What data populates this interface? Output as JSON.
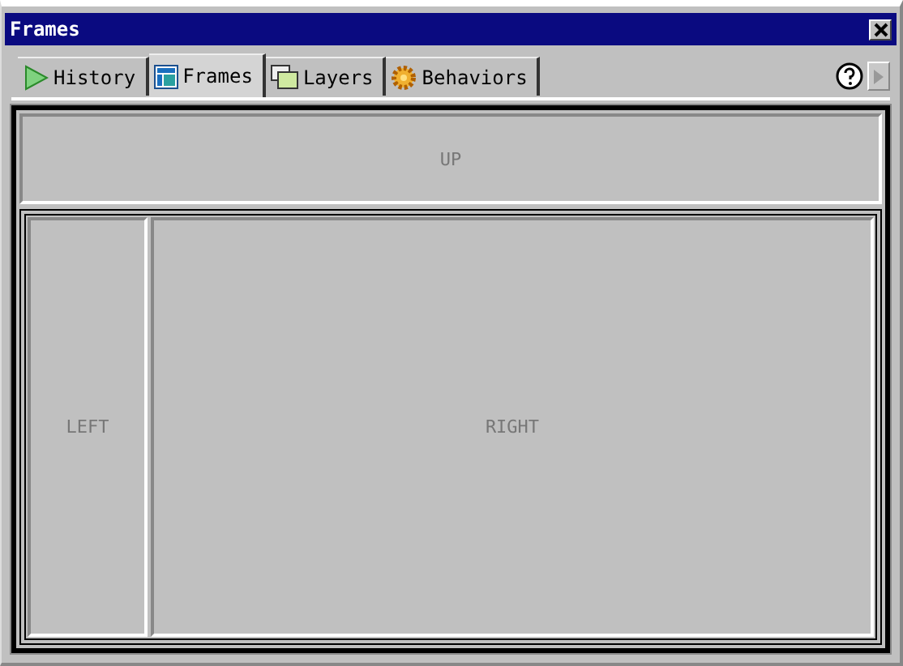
{
  "window": {
    "title": "Frames"
  },
  "tabs": [
    {
      "label": "History",
      "kind": "history",
      "selected": false
    },
    {
      "label": "Frames",
      "kind": "frames",
      "selected": true
    },
    {
      "label": "Layers",
      "kind": "layers",
      "selected": false
    },
    {
      "label": "Behaviors",
      "kind": "behaviors",
      "selected": false
    }
  ],
  "frames": {
    "top": {
      "label": "UP"
    },
    "left": {
      "label": "LEFT"
    },
    "right": {
      "label": "RIGHT"
    }
  }
}
